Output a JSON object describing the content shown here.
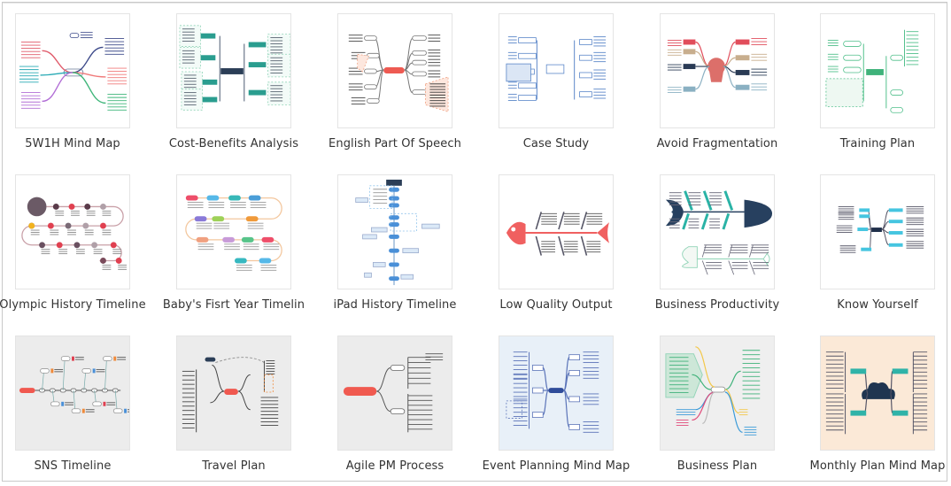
{
  "gallery": {
    "templates": [
      {
        "title": "5W1H Mind Map",
        "thumbnail_bg": "#ffffff",
        "style": "mindmap-colorful"
      },
      {
        "title": "Cost-Benefits Analysis",
        "thumbnail_bg": "#ffffff",
        "style": "mindmap-teal-dashed"
      },
      {
        "title": "English Part Of Speech",
        "thumbnail_bg": "#ffffff",
        "style": "mindmap-red-gray"
      },
      {
        "title": "Case Study",
        "thumbnail_bg": "#ffffff",
        "style": "mindmap-blue"
      },
      {
        "title": "Avoid Fragmentation",
        "thumbnail_bg": "#ffffff",
        "style": "mindmap-head"
      },
      {
        "title": "Training Plan",
        "thumbnail_bg": "#ffffff",
        "style": "mindmap-green"
      },
      {
        "title": "Olympic History Timeline",
        "thumbnail_bg": "#ffffff",
        "style": "timeline-snake-dark"
      },
      {
        "title": "Baby's Fisrt Year Timelin",
        "thumbnail_bg": "#ffffff",
        "style": "timeline-snake-pastel"
      },
      {
        "title": "iPad History Timeline",
        "thumbnail_bg": "#ffffff",
        "style": "timeline-vertical-blue"
      },
      {
        "title": "Low Quality Output",
        "thumbnail_bg": "#ffffff",
        "style": "fishbone-red"
      },
      {
        "title": "Business Productivity",
        "thumbnail_bg": "#ffffff",
        "style": "fishbone-navy"
      },
      {
        "title": "Know Yourself",
        "thumbnail_bg": "#ffffff",
        "style": "mindmap-navy-cyan"
      },
      {
        "title": "SNS Timeline",
        "thumbnail_bg": "#ececec",
        "style": "timeline-horizontal"
      },
      {
        "title": "Travel Plan",
        "thumbnail_bg": "#ececec",
        "style": "mindmap-dark-red"
      },
      {
        "title": "Agile PM Process",
        "thumbnail_bg": "#ececec",
        "style": "mindmap-right-red"
      },
      {
        "title": "Event Planning Mind Map",
        "thumbnail_bg": "#e8f0f8",
        "style": "mindmap-indigo"
      },
      {
        "title": "Business Plan",
        "thumbnail_bg": "#efefef",
        "style": "mindmap-multicolor"
      },
      {
        "title": "Monthly Plan Mind Map",
        "thumbnail_bg": "#fbe9d7",
        "style": "mindmap-cloud"
      }
    ]
  },
  "colors": {
    "label_text": "#333333",
    "thumb_border": "#e4e4e4",
    "frame_border": "#c9c9c9"
  }
}
